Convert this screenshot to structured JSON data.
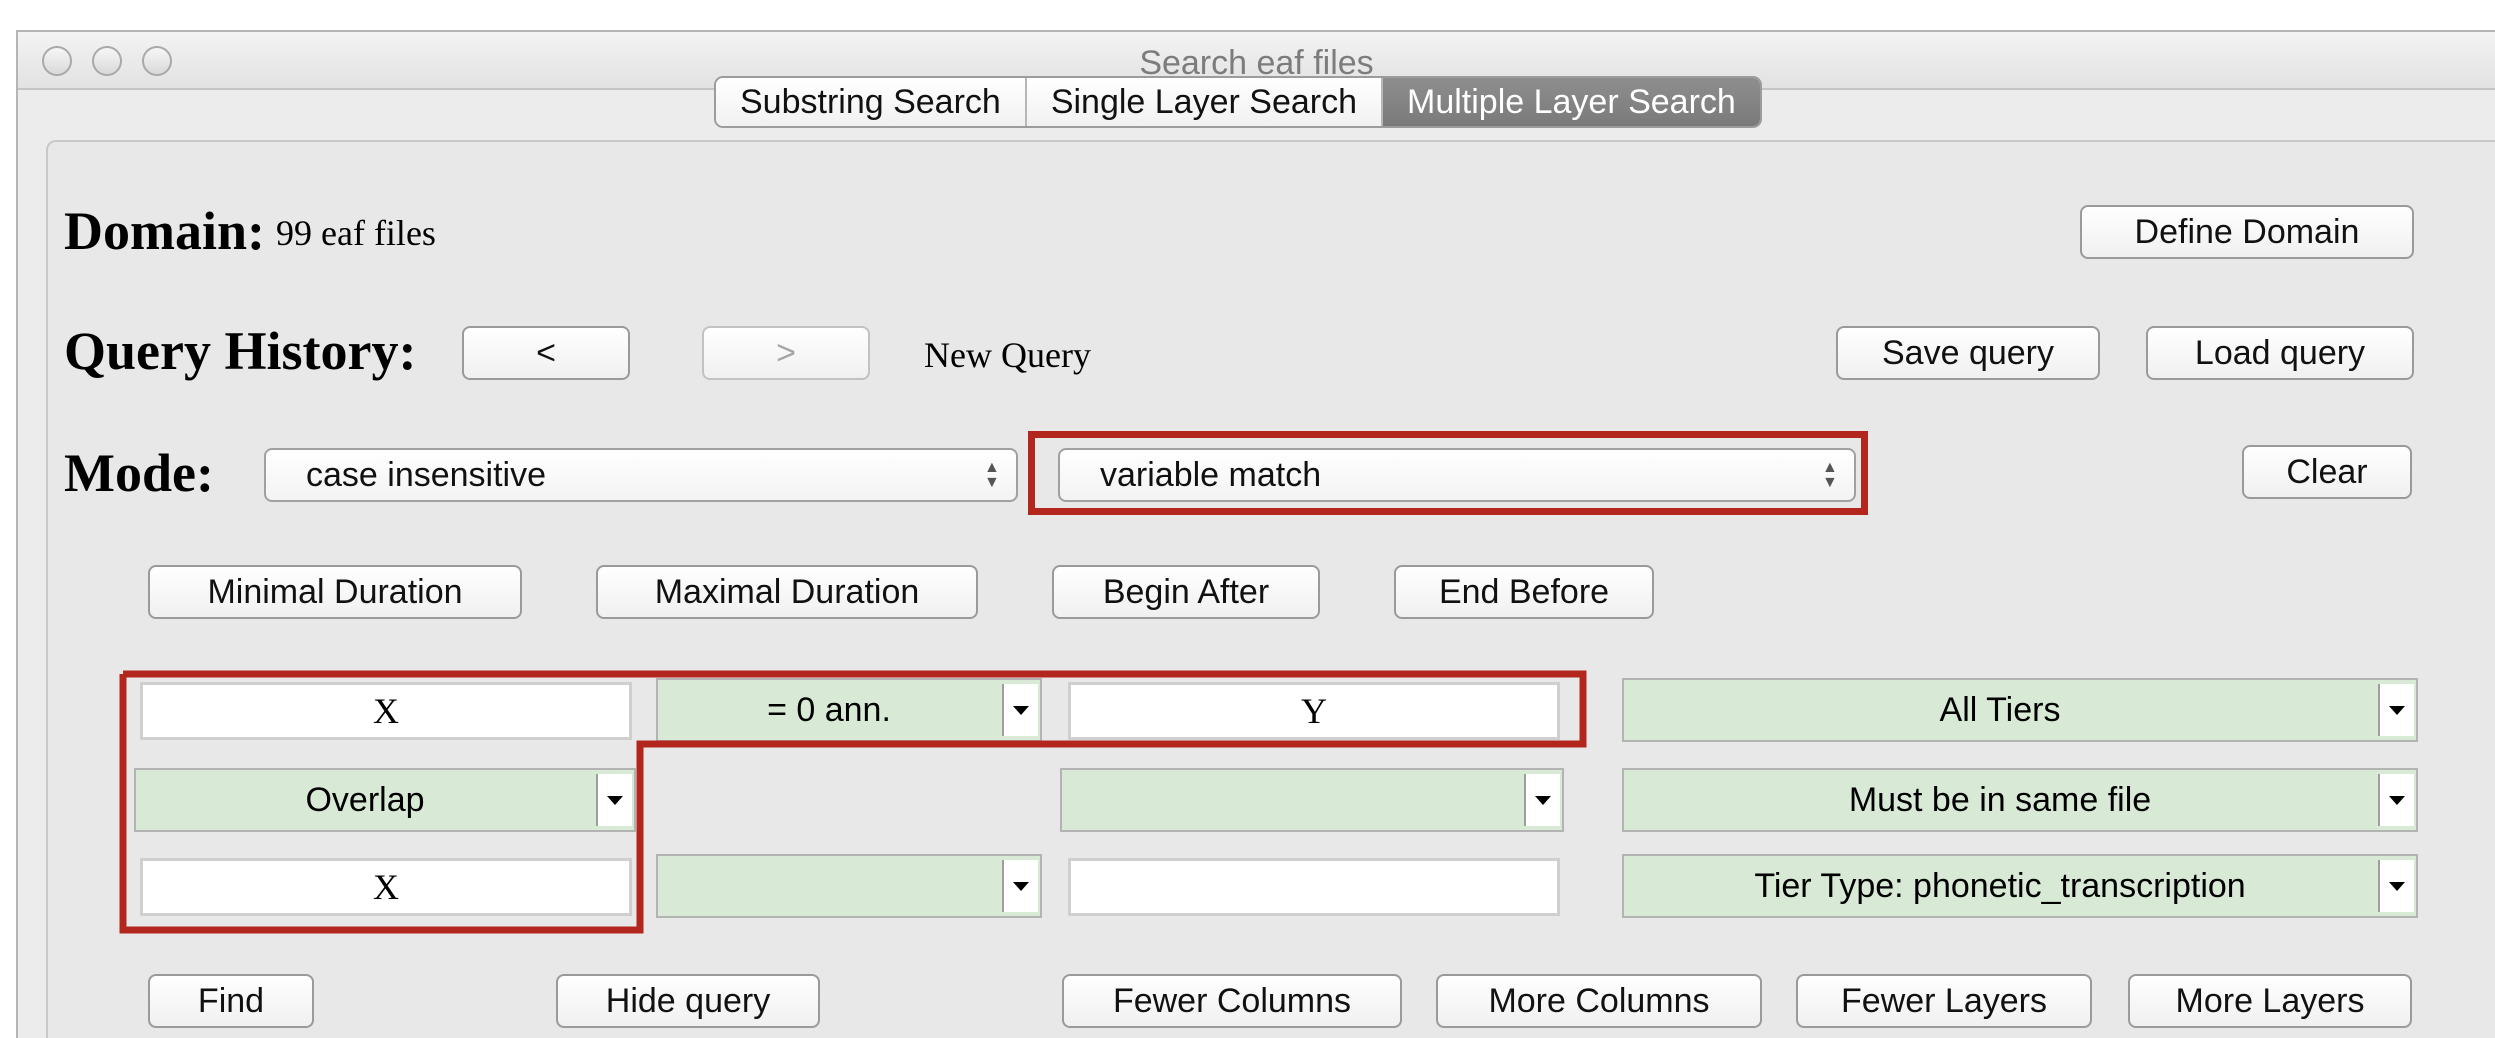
{
  "window": {
    "title": "Search eaf files"
  },
  "tabs": [
    {
      "label": "Substring Search",
      "active": false
    },
    {
      "label": "Single Layer Search",
      "active": false
    },
    {
      "label": "Multiple Layer Search",
      "active": true
    }
  ],
  "domain": {
    "label": "Domain:",
    "value": "99 eaf files",
    "define_button": "Define Domain"
  },
  "history": {
    "label": "Query History:",
    "back": "<",
    "forward": ">",
    "status": "New Query",
    "save": "Save query",
    "load": "Load query"
  },
  "mode": {
    "label": "Mode:",
    "case_select": "case insensitive",
    "match_select": "variable match",
    "clear": "Clear"
  },
  "constraints": {
    "min_duration": "Minimal Duration",
    "max_duration": "Maximal Duration",
    "begin_after": "Begin After",
    "end_before": "End Before"
  },
  "grid": {
    "row1": {
      "field1": "X",
      "distance": "= 0 ann.",
      "field2": "Y",
      "tiers": "All Tiers"
    },
    "row2": {
      "relation": "Overlap",
      "relation2": "",
      "file_scope": "Must be in same file"
    },
    "row3": {
      "field1": "X",
      "distance": "",
      "field2": "",
      "tier_type": "Tier Type: phonetic_transcription"
    }
  },
  "actions": {
    "find": "Find",
    "hide": "Hide query",
    "fewer_columns": "Fewer Columns",
    "more_columns": "More Columns",
    "fewer_layers": "Fewer Layers",
    "more_layers": "More Layers"
  },
  "colors": {
    "highlight": "#b3261e",
    "combo_fill": "#d8ead6",
    "active_tab": "#858585"
  }
}
